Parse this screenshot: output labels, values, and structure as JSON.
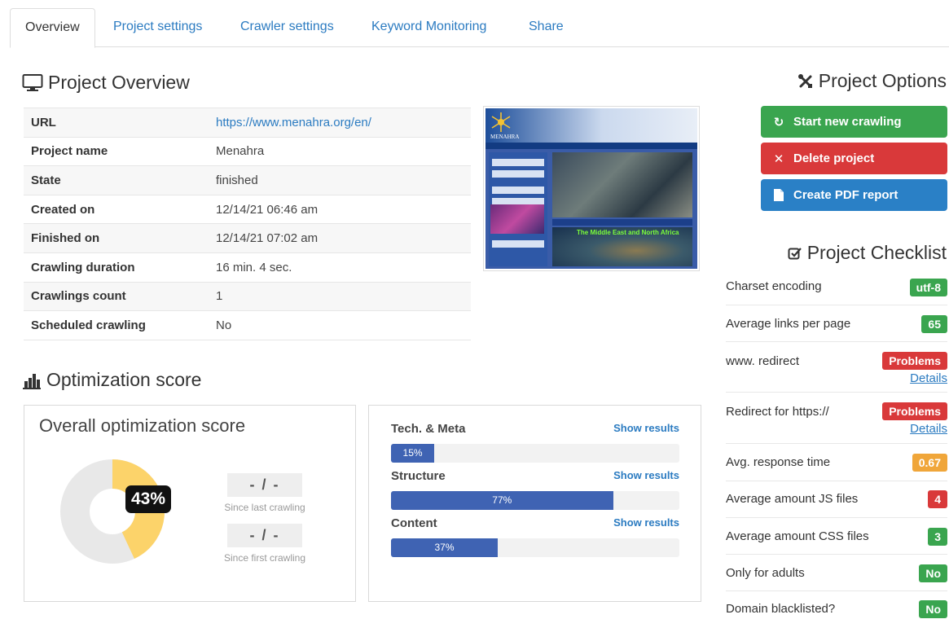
{
  "tabs": [
    {
      "label": "Overview"
    },
    {
      "label": "Project settings"
    },
    {
      "label": "Crawler settings"
    },
    {
      "label": "Keyword Monitoring"
    },
    {
      "label": "Share"
    }
  ],
  "overview": {
    "title": "Project Overview",
    "rows": [
      {
        "key": "URL",
        "value": "https://www.menahra.org/en/"
      },
      {
        "key": "Project name",
        "value": "Menahra"
      },
      {
        "key": "State",
        "value": "finished"
      },
      {
        "key": "Created on",
        "value": "12/14/21 06:46 am"
      },
      {
        "key": "Finished on",
        "value": "12/14/21 07:02 am"
      },
      {
        "key": "Crawling duration",
        "value": "16 min. 4 sec."
      },
      {
        "key": "Crawlings count",
        "value": "1"
      },
      {
        "key": "Scheduled crawling",
        "value": "No"
      }
    ],
    "thumbnail": {
      "logo_text": "MENAHRA",
      "map_text": "The Middle East and North Africa"
    }
  },
  "optimization": {
    "title": "Optimization score",
    "overall": {
      "title": "Overall optimization score",
      "percent_label": "43%",
      "percent": 43,
      "since_last_value": "- / -",
      "since_last_label": "Since last crawling",
      "since_first_value": "- / -",
      "since_first_label": "Since first crawling",
      "fill_color": "#fcd36a",
      "track_color": "#e8e8e8"
    },
    "categories": [
      {
        "name": "Tech. & Meta",
        "percent": 15,
        "label": "15%",
        "link": "Show results"
      },
      {
        "name": "Structure",
        "percent": 77,
        "label": "77%",
        "link": "Show results"
      },
      {
        "name": "Content",
        "percent": 37,
        "label": "37%",
        "link": "Show results"
      }
    ]
  },
  "options": {
    "title": "Project Options",
    "buttons": [
      {
        "label": "Start new crawling",
        "icon": "refresh-icon",
        "color": "#3aa54f"
      },
      {
        "label": "Delete project",
        "icon": "close-icon",
        "color": "#d9393a"
      },
      {
        "label": "Create PDF report",
        "icon": "file-icon",
        "color": "#2a80c6"
      }
    ]
  },
  "checklist": {
    "title": "Project Checklist",
    "items": [
      {
        "label": "Charset encoding",
        "badge": "utf-8",
        "status": "green"
      },
      {
        "label": "Average links per page",
        "badge": "65",
        "status": "green"
      },
      {
        "label": "www. redirect",
        "badge": "Problems",
        "status": "red",
        "link": "Details"
      },
      {
        "label": "Redirect for https://",
        "badge": "Problems",
        "status": "red",
        "link": "Details"
      },
      {
        "label": "Avg. response time",
        "badge": "0.67",
        "status": "orange"
      },
      {
        "label": "Average amount JS files",
        "badge": "4",
        "status": "red"
      },
      {
        "label": "Average amount CSS files",
        "badge": "3",
        "status": "green"
      },
      {
        "label": "Only for adults",
        "badge": "No",
        "status": "green"
      },
      {
        "label": "Domain blacklisted?",
        "badge": "No",
        "status": "green"
      }
    ]
  }
}
